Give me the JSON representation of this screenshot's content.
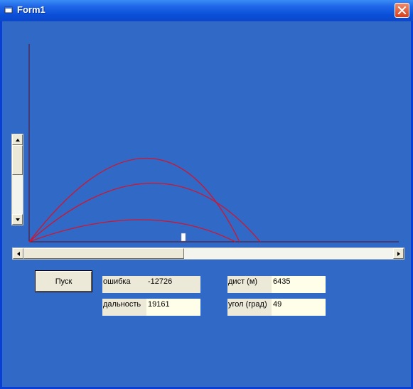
{
  "window": {
    "title": "Form1"
  },
  "controls": {
    "start_button": "Пуск",
    "error": {
      "label": "ошибка",
      "value": "-12726"
    },
    "range": {
      "label": "дальность",
      "value": "19161"
    },
    "distance": {
      "label": "дист (м)",
      "value": "6435"
    },
    "angle": {
      "label": "угол (град)",
      "value": "49"
    }
  },
  "colors": {
    "background": "#3169c6",
    "trajectory": "#d3142c",
    "axes": "#5a1020"
  }
}
